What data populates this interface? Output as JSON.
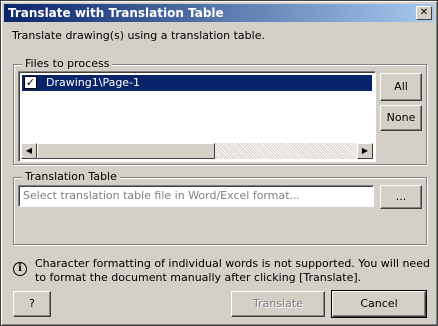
{
  "window": {
    "title": "Translate with Translation Table",
    "close_glyph": "✕"
  },
  "instruction": "Translate drawing(s) using a translation table.",
  "files_group": {
    "legend": "Files to process",
    "items": [
      {
        "label": "Drawing1\\Page-1",
        "checked": true,
        "check_glyph": "✓"
      }
    ],
    "all_button": "All",
    "none_button": "None",
    "scroll_left_glyph": "◀",
    "scroll_right_glyph": "▶"
  },
  "table_group": {
    "legend": "Translation Table",
    "file_placeholder": "Select translation table file in Word/Excel format...",
    "browse_button": "..."
  },
  "notice": {
    "icon": "info-icon",
    "text": "Character formatting of individual words is not supported. You will need to format the document manually after clicking [Translate]."
  },
  "footer": {
    "help_button": "?",
    "translate_button": "Translate",
    "translate_enabled": false,
    "cancel_button": "Cancel"
  }
}
